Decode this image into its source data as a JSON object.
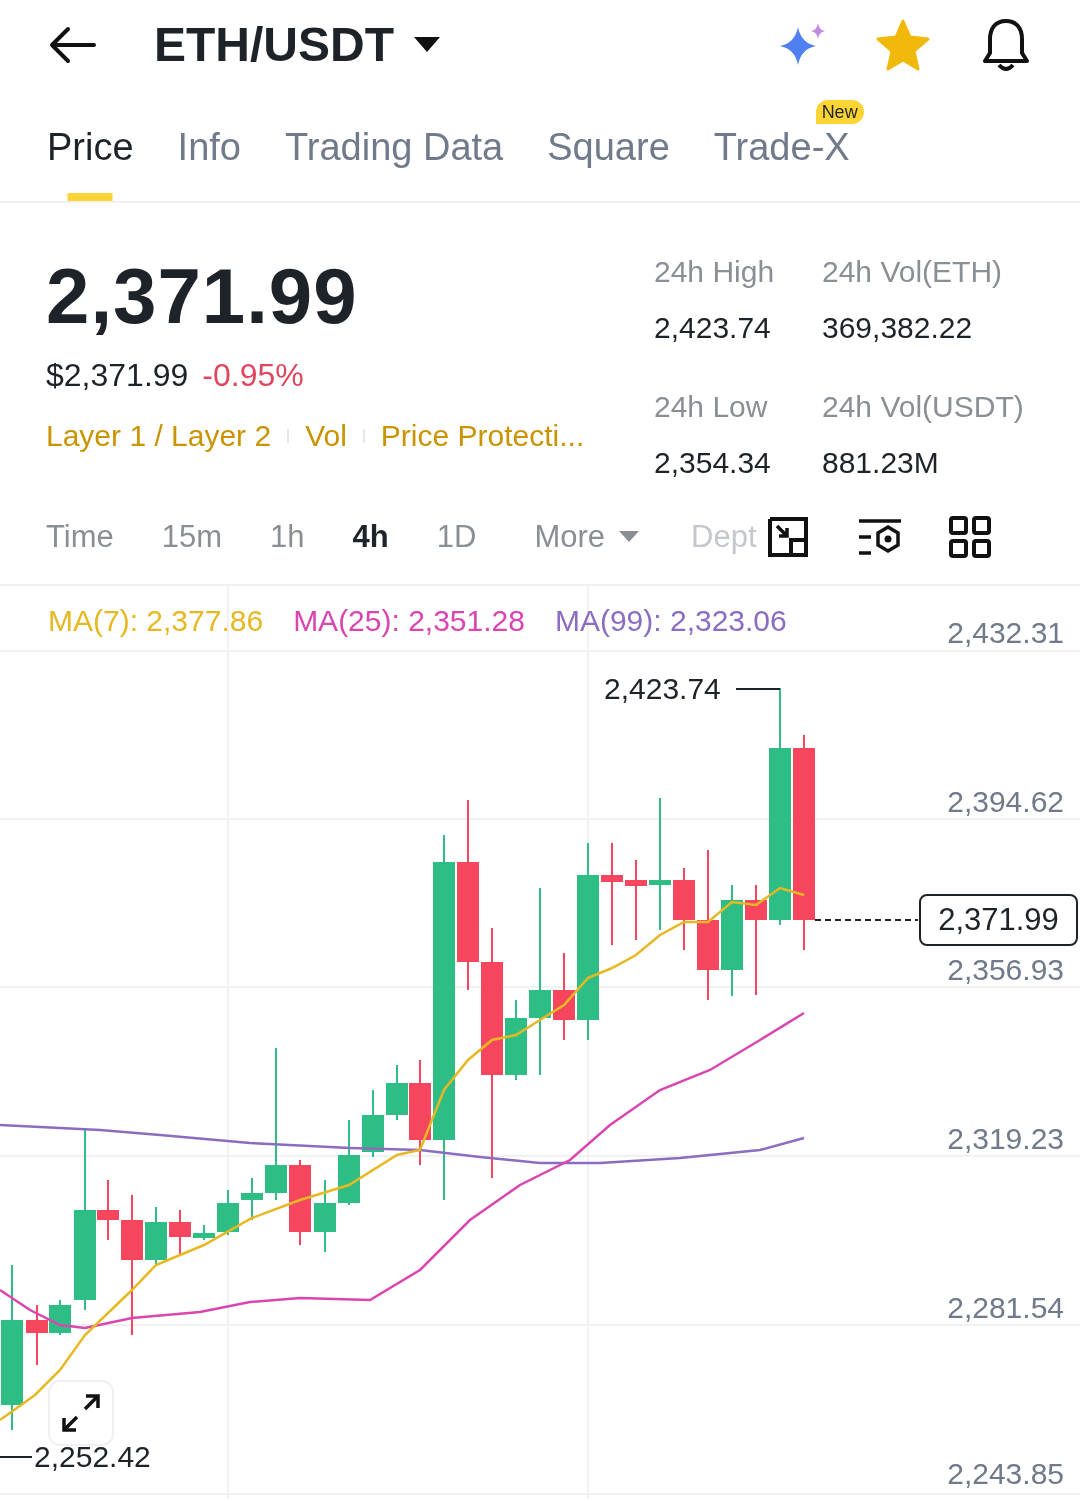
{
  "header": {
    "title": "ETH/USDT"
  },
  "tabs": [
    {
      "label": "Price",
      "selected": true
    },
    {
      "label": "Info",
      "selected": false
    },
    {
      "label": "Trading Data",
      "selected": false
    },
    {
      "label": "Square",
      "selected": false
    },
    {
      "label": "Trade-X",
      "selected": false,
      "badge": "New"
    }
  ],
  "ticker": {
    "price": "2,371.99",
    "usd_price": "$2,371.99",
    "change": "-0.95%",
    "tags": [
      "Layer 1 / Layer 2",
      "Vol",
      "Price Protecti..."
    ],
    "stats": [
      {
        "label": "24h High",
        "value": "2,423.74"
      },
      {
        "label": "24h Vol(ETH)",
        "value": "369,382.22"
      },
      {
        "label": "24h Low",
        "value": "2,354.34"
      },
      {
        "label": "24h Vol(USDT)",
        "value": "881.23M"
      }
    ]
  },
  "intervals": [
    {
      "label": "Time",
      "selected": false
    },
    {
      "label": "15m",
      "selected": false
    },
    {
      "label": "1h",
      "selected": false
    },
    {
      "label": "4h",
      "selected": true
    },
    {
      "label": "1D",
      "selected": false
    }
  ],
  "more": "More",
  "depth": "Dept",
  "indicators": [
    {
      "label": "MA(7): 2,377.86",
      "color": "#e6b822"
    },
    {
      "label": "MA(25): 2,351.28",
      "color": "#d946b0"
    },
    {
      "label": "MA(99): 2,323.06",
      "color": "#8b6cc0"
    }
  ],
  "chart": {
    "y_labels": [
      "2,432.31",
      "2,394.62",
      "2,356.93",
      "2,319.23",
      "2,281.54",
      "2,243.85"
    ],
    "high_marker": "2,423.74",
    "low_marker": "2,252.42",
    "current_price": "2,371.99"
  }
}
